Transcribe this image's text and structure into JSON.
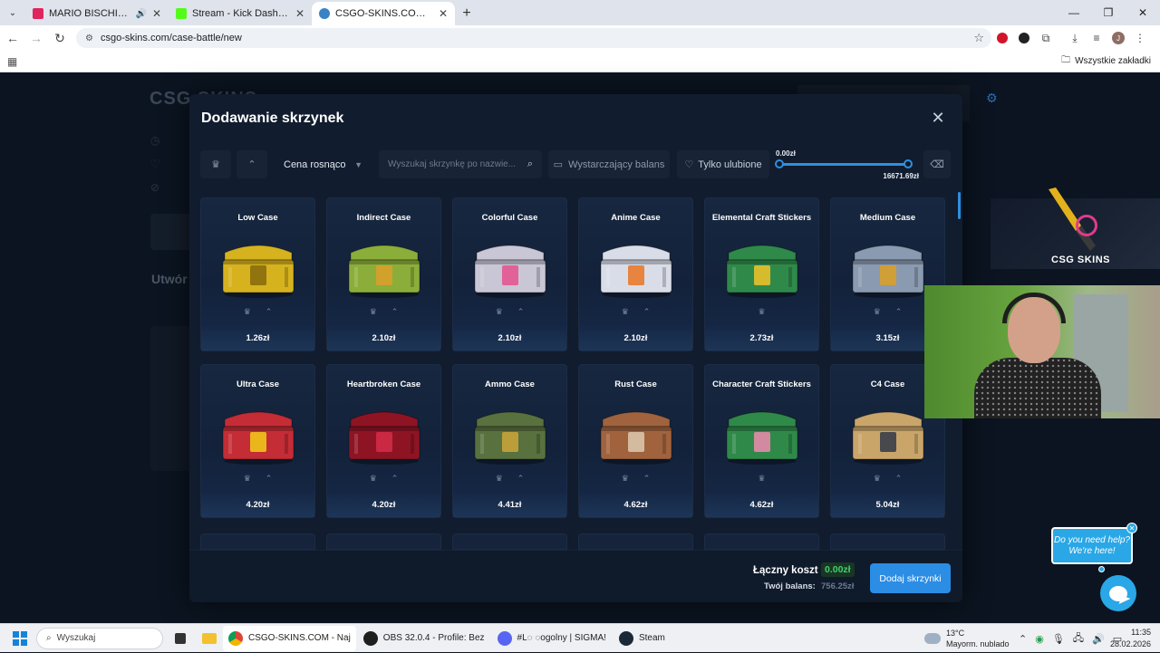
{
  "browser": {
    "tabs": [
      {
        "title": "MARIO BISCHIN feat BOYS",
        "favicon_color": "#e0245e",
        "audio": true,
        "active": false
      },
      {
        "title": "Stream - Kick Dashboard",
        "favicon_color": "#53fc18",
        "audio": false,
        "active": false
      },
      {
        "title": "CSGO-SKINS.COM - Najlepsze",
        "favicon_color": "#3b82c4",
        "audio": false,
        "active": true
      }
    ],
    "url": "csgo-skins.com/case-battle/new",
    "bookmarks_all": "Wszystkie zakładki",
    "profile_initial": "J"
  },
  "background_page": {
    "logo": "CSG SKINS",
    "heading": "Utwór"
  },
  "modal": {
    "title": "Dodawanie skrzynek",
    "sort_label": "Cena rosnąco",
    "search_placeholder": "Wyszukaj skrzynkę po nazwie...",
    "filter_balance": "Wystarczający balans",
    "filter_favorites": "Tylko ulubione",
    "price_min": "0.00zł",
    "price_max": "16671.69zł",
    "price_range_fill": 1.0,
    "cases": [
      {
        "name": "Low Case",
        "price": "1.26zł",
        "color": "#d6b21e",
        "accent": "#8a6d0c",
        "icon_count": 2
      },
      {
        "name": "Indirect Case",
        "price": "2.10zł",
        "color": "#8bae3a",
        "accent": "#d8a02a",
        "icon_count": 2
      },
      {
        "name": "Colorful Case",
        "price": "2.10zł",
        "color": "#c9c6d6",
        "accent": "#e2568f",
        "icon_count": 2
      },
      {
        "name": "Anime Case",
        "price": "2.10zł",
        "color": "#d9dde8",
        "accent": "#e87a2c",
        "icon_count": 2
      },
      {
        "name": "Elemental Craft Stickers",
        "price": "2.73zł",
        "color": "#2f8a4a",
        "accent": "#e8c02a",
        "icon_count": 1
      },
      {
        "name": "Medium Case",
        "price": "3.15zł",
        "color": "#8a9ab0",
        "accent": "#d8a02a",
        "icon_count": 2
      },
      {
        "name": "Ultra Case",
        "price": "4.20zł",
        "color": "#c42c36",
        "accent": "#f0c419",
        "icon_count": 2
      },
      {
        "name": "Heartbroken Case",
        "price": "4.20zł",
        "color": "#8e1424",
        "accent": "#d12a48",
        "icon_count": 2
      },
      {
        "name": "Ammo Case",
        "price": "4.41zł",
        "color": "#58713e",
        "accent": "#c7a33a",
        "icon_count": 2
      },
      {
        "name": "Rust Case",
        "price": "4.62zł",
        "color": "#a0633e",
        "accent": "#d9c3a8",
        "icon_count": 2
      },
      {
        "name": "Character Craft Stickers",
        "price": "4.62zł",
        "color": "#2f8a4a",
        "accent": "#e38aa8",
        "icon_count": 1
      },
      {
        "name": "C4 Case",
        "price": "5.04zł",
        "color": "#c9a56a",
        "accent": "#3a3f4a",
        "icon_count": 2
      }
    ],
    "total_label": "Łączny koszt",
    "total_value": "0.00zł",
    "balance_label": "Twój balans:",
    "balance_value": "756.25zł",
    "add_button": "Dodaj skrzynki"
  },
  "overlays": {
    "promo_logo": "CSG SKINS",
    "help_line1": "Do you need help?",
    "help_line2": "We're here!"
  },
  "taskbar": {
    "search_placeholder": "Wyszukaj",
    "apps": [
      {
        "label": "CSGO-SKINS.COM - Naj",
        "color": "#3b82c4",
        "active": true
      },
      {
        "label": "OBS 32.0.4 - Profile: Bez",
        "color": "#1e1e1e",
        "active": false
      },
      {
        "label": "#L◌ ◌ogolny | SIGMA!",
        "color": "#5865f2",
        "active": false
      },
      {
        "label": "Steam",
        "color": "#1b2838",
        "active": false
      }
    ],
    "weather_temp": "13°C",
    "weather_desc": "Mayorm. nublado",
    "time": "11:35",
    "date": "28.02.2026"
  }
}
